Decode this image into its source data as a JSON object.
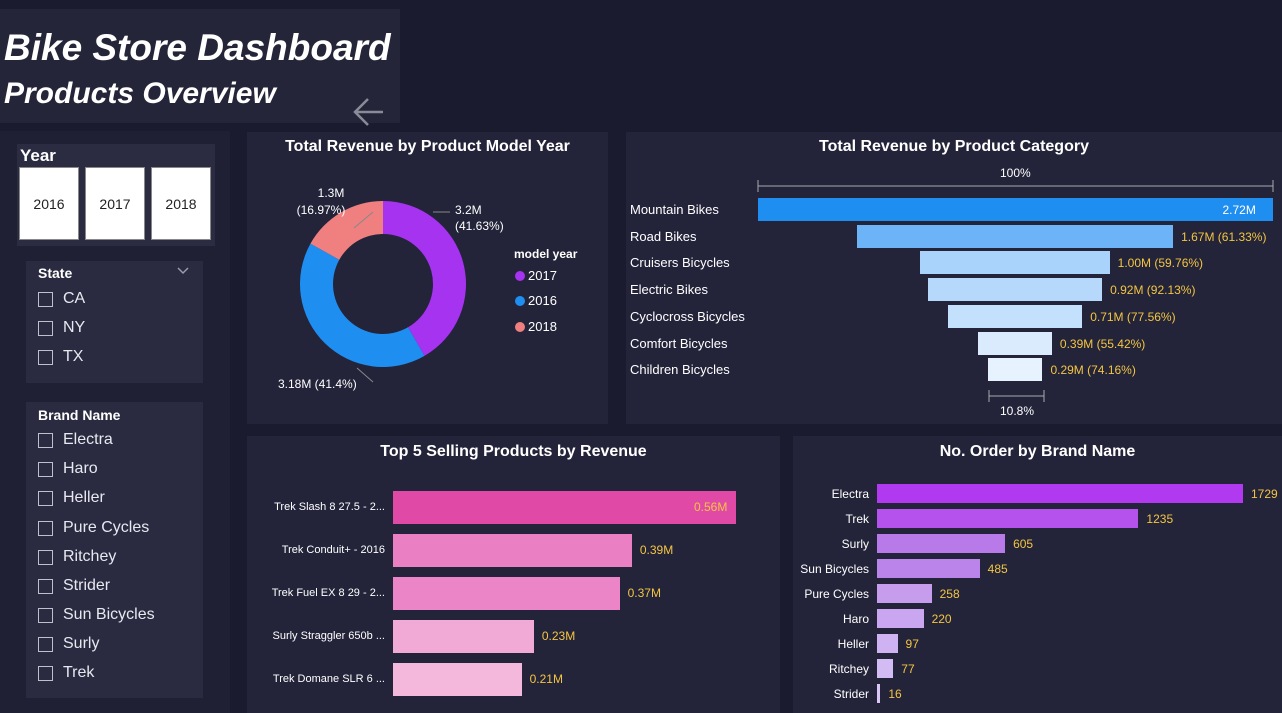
{
  "header": {
    "title": "Bike Store Dashboard",
    "subtitle": "Products Overview",
    "back_icon": "arrow-left-icon"
  },
  "filters": {
    "year": {
      "title": "Year",
      "options": [
        "2016",
        "2017",
        "2018"
      ]
    },
    "state": {
      "title": "State",
      "options": [
        "CA",
        "NY",
        "TX"
      ]
    },
    "brand": {
      "title": "Brand Name",
      "options": [
        "Electra",
        "Haro",
        "Heller",
        "Pure Cycles",
        "Ritchey",
        "Strider",
        "Sun Bicycles",
        "Surly",
        "Trek"
      ]
    }
  },
  "colors": {
    "y2017": "#a633f0",
    "y2016": "#1f8ef1",
    "y2018": "#f08080",
    "value_label": "#f4c542"
  },
  "chart_data": [
    {
      "type": "pie",
      "title": "Total Revenue by Product Model Year",
      "legend_title": "model year",
      "legend": [
        "2017",
        "2016",
        "2018"
      ],
      "slices": [
        {
          "label": "2017",
          "value": 3.2,
          "display": "3.2M",
          "pct": "(41.63%)"
        },
        {
          "label": "2016",
          "value": 3.18,
          "display": "3.18M (41.4%)",
          "pct": ""
        },
        {
          "label": "2018",
          "value": 1.3,
          "display": "1.3M",
          "pct": "(16.97%)"
        }
      ]
    },
    {
      "type": "bar",
      "subtype": "funnel",
      "title": "Total Revenue by Product Category",
      "top_pct": "100%",
      "bottom_pct": "10.8%",
      "categories": [
        "Mountain Bikes",
        "Road Bikes",
        "Cruisers Bicycles",
        "Electric Bikes",
        "Cyclocross Bicycles",
        "Comfort Bicycles",
        "Children Bicycles"
      ],
      "values": [
        2.72,
        1.67,
        1.0,
        0.92,
        0.71,
        0.39,
        0.29
      ],
      "labels": [
        "2.72M",
        "1.67M (61.33%)",
        "1.00M (59.76%)",
        "0.92M (92.13%)",
        "0.71M (77.56%)",
        "0.39M (55.42%)",
        "0.29M (74.16%)"
      ]
    },
    {
      "type": "bar",
      "title": "Top 5 Selling Products by Revenue",
      "categories": [
        "Trek Slash 8 27.5 - 2...",
        "Trek Conduit+ - 2016",
        "Trek Fuel EX 8 29 - 2...",
        "Surly Straggler 650b ...",
        "Trek Domane SLR 6 ..."
      ],
      "values": [
        0.56,
        0.39,
        0.37,
        0.23,
        0.21
      ],
      "labels": [
        "0.56M",
        "0.39M",
        "0.37M",
        "0.23M",
        "0.21M"
      ]
    },
    {
      "type": "bar",
      "title": "No. Order by Brand Name",
      "categories": [
        "Electra",
        "Trek",
        "Surly",
        "Sun Bicycles",
        "Pure Cycles",
        "Haro",
        "Heller",
        "Ritchey",
        "Strider"
      ],
      "values": [
        1729,
        1235,
        605,
        485,
        258,
        220,
        97,
        77,
        16
      ],
      "labels": [
        "1729",
        "1235",
        "605",
        "485",
        "258",
        "220",
        "97",
        "77",
        "16"
      ]
    }
  ]
}
